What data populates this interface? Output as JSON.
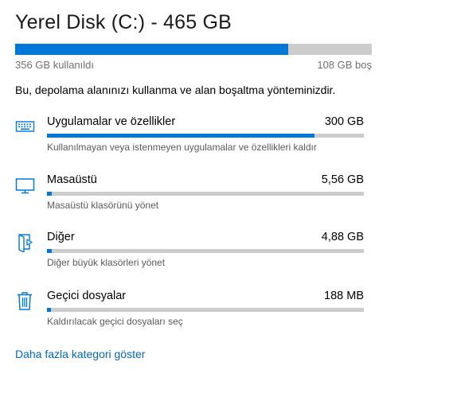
{
  "disk": {
    "title": "Yerel Disk (C:) - 465 GB",
    "used_label": "356 GB kullanıldı",
    "free_label": "108 GB boş",
    "used_fraction": 0.766
  },
  "description": "Bu, depolama alanınızı kullanma ve alan boşaltma yönteminizdir.",
  "categories": [
    {
      "icon": "keyboard-icon",
      "name": "Uygulamalar ve özellikler",
      "size": "300 GB",
      "description": "Kullanılmayan veya istenmeyen uygulamalar ve özellikleri kaldır",
      "fraction": 0.845
    },
    {
      "icon": "monitor-icon",
      "name": "Masaüstü",
      "size": "5,56 GB",
      "description": "Masaüstü klasörünü yönet",
      "fraction": 0.016
    },
    {
      "icon": "folder-icon",
      "name": "Diğer",
      "size": "4,88 GB",
      "description": "Diğer büyük klasörleri yönet",
      "fraction": 0.014
    },
    {
      "icon": "trash-icon",
      "name": "Geçici dosyalar",
      "size": "188 MB",
      "description": "Kaldırılacak geçici dosyaları seç",
      "fraction": 0.004
    }
  ],
  "more_link": "Daha fazla kategori göster",
  "colors": {
    "accent": "#0078d7",
    "bar_track": "#cccccc",
    "link": "#0067b8"
  }
}
